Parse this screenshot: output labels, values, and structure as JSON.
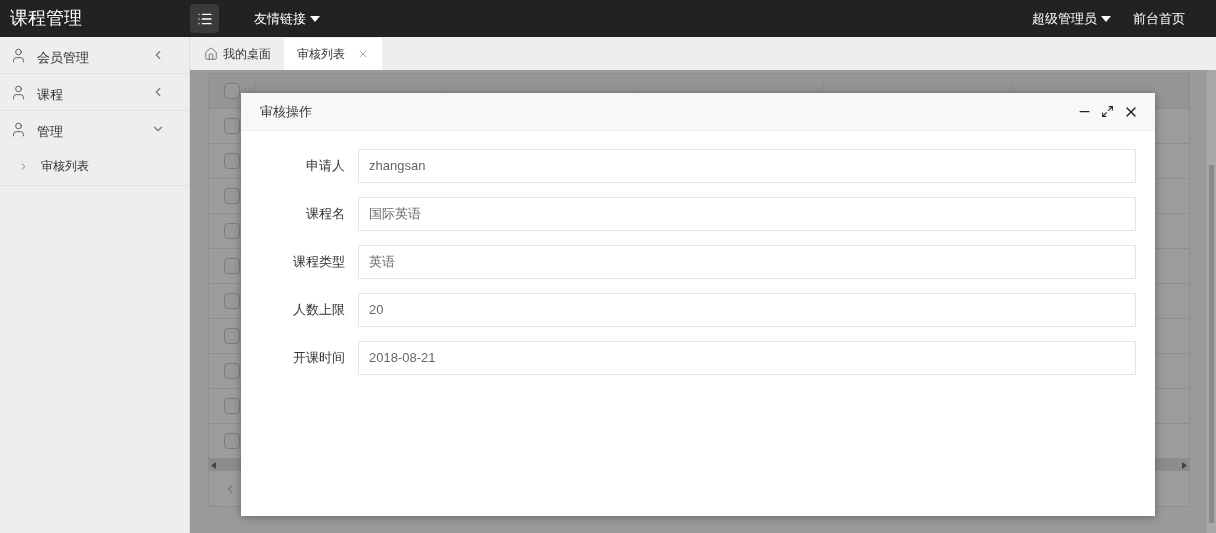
{
  "app_title": "课程管理",
  "header": {
    "links_menu": "友情链接",
    "user_menu": "超级管理员",
    "home_link": "前台首页"
  },
  "sidebar": {
    "items": [
      {
        "label": "会员管理",
        "expanded": false
      },
      {
        "label": "课程",
        "expanded": false
      },
      {
        "label": "管理",
        "expanded": true,
        "children": [
          {
            "label": "审核列表"
          }
        ]
      }
    ]
  },
  "tabs": [
    {
      "label": "我的桌面",
      "selected": false,
      "kind": "home"
    },
    {
      "label": "审核列表",
      "selected": true,
      "kind": "closable"
    }
  ],
  "table": {
    "header_checked": false,
    "rows": [
      {
        "checked": false
      },
      {
        "checked": false
      },
      {
        "checked": false
      },
      {
        "checked": false
      },
      {
        "checked": false
      },
      {
        "checked": false
      },
      {
        "checked": false
      },
      {
        "checked": false
      },
      {
        "checked": false
      },
      {
        "checked": false
      }
    ]
  },
  "dialog": {
    "title": "审核操作",
    "fields": [
      {
        "label": "申请人",
        "value": "zhangsan"
      },
      {
        "label": "课程名",
        "value": "国际英语"
      },
      {
        "label": "课程类型",
        "value": "英语"
      },
      {
        "label": "人数上限",
        "value": "20"
      },
      {
        "label": "开课时间",
        "value": "2018-08-21"
      }
    ]
  }
}
